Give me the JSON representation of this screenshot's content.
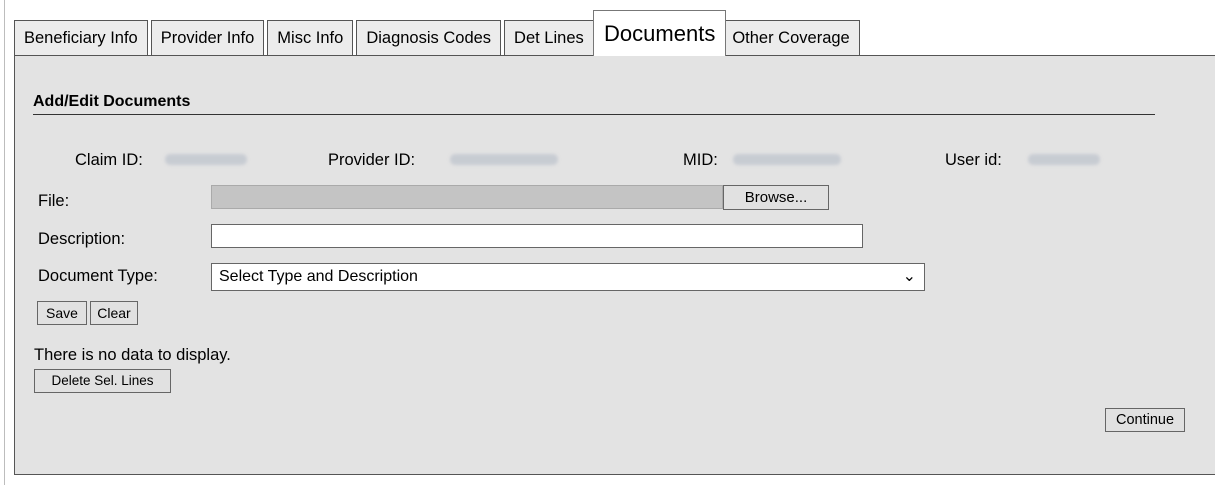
{
  "tabs": [
    {
      "label": "Beneficiary Info"
    },
    {
      "label": "Provider Info"
    },
    {
      "label": "Misc Info"
    },
    {
      "label": "Diagnosis Codes"
    },
    {
      "label": "Det Lines"
    },
    {
      "label": "Documents"
    },
    {
      "label": "Other Coverage"
    }
  ],
  "active_tab": "Documents",
  "section": {
    "title": "Add/Edit Documents"
  },
  "ids": {
    "claim_label": "Claim ID:",
    "provider_label": "Provider ID:",
    "mid_label": "MID:",
    "user_label": "User id:"
  },
  "form": {
    "file_label": "File:",
    "browse_label": "Browse...",
    "description_label": "Description:",
    "description_value": "",
    "doc_type_label": "Document Type:",
    "doc_type_selected": "Select Type and Description",
    "save_label": "Save",
    "clear_label": "Clear"
  },
  "results": {
    "empty_message": "There is no data to display.",
    "delete_label": "Delete Sel. Lines"
  },
  "footer": {
    "continue_label": "Continue"
  },
  "icons": {
    "dropdown": "chevron-down-icon"
  },
  "colors": {
    "panel_bg": "#e3e3e3",
    "tab_bg": "#ececec",
    "active_tab_bg": "#ffffff"
  }
}
